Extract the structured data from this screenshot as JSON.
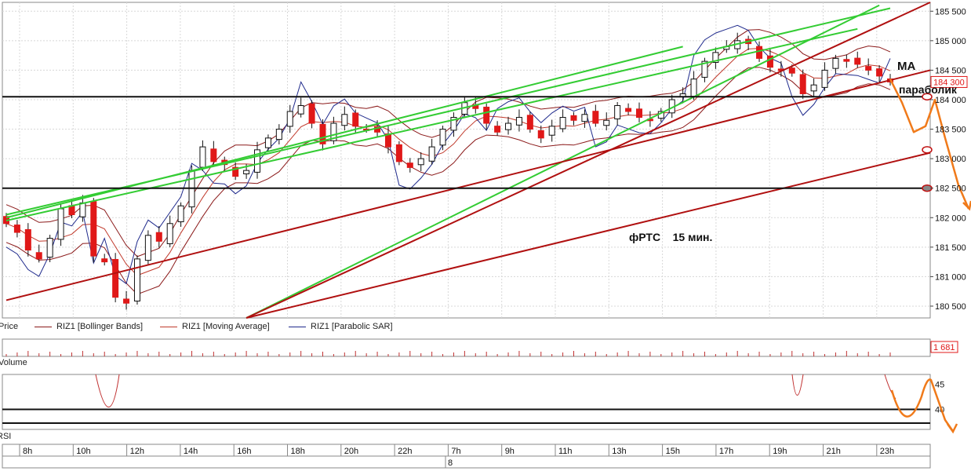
{
  "chart_data": {
    "type": "candlestick",
    "annotation": "фРТС    15 мин.",
    "callouts": [
      "MA",
      "параболик"
    ],
    "price_axis": {
      "ticks": [
        "185 500",
        "185 000",
        "184 500",
        "184 000",
        "183 500",
        "183 000",
        "182 500",
        "182 000",
        "181 500",
        "181 000",
        "180 500"
      ],
      "tick_values": [
        185500,
        185000,
        184500,
        184000,
        183500,
        183000,
        182500,
        182000,
        181500,
        181000,
        180500
      ],
      "ylim": [
        180300,
        185650
      ]
    },
    "last_price_badge": "184 300",
    "volume_badge": "1 681",
    "rsi_axis": {
      "ticks": [
        "45",
        "40"
      ],
      "tick_values": [
        45,
        40
      ]
    },
    "time_axis": {
      "labels": [
        "8h",
        "10h",
        "12h",
        "14h",
        "16h",
        "18h",
        "20h",
        "22h",
        "7h",
        "9h",
        "11h",
        "13h",
        "15h",
        "17h",
        "19h",
        "21h",
        "23h"
      ],
      "date_label": "8"
    },
    "horizontal_levels": [
      184050,
      182500
    ],
    "series_legend": [
      {
        "name": "Price",
        "color": "#000000"
      },
      {
        "name": "RIZ1 [Bollinger Bands]",
        "color": "#8b1a1a"
      },
      {
        "name": "RIZ1 [Moving Average]",
        "color": "#c0392b"
      },
      {
        "name": "RIZ1 [Parabolic SAR]",
        "color": "#1f2a8c"
      }
    ],
    "pane_labels": {
      "volume": "Volume",
      "rsi": "RSI"
    },
    "close_path": [
      181900,
      181750,
      181450,
      181300,
      181650,
      182150,
      182050,
      182250,
      181350,
      181250,
      180650,
      180550,
      181300,
      181700,
      181600,
      181900,
      182200,
      182800,
      183200,
      182950,
      182900,
      182700,
      182800,
      183150,
      183350,
      183500,
      183800,
      183900,
      183600,
      183250,
      183600,
      183750,
      183550,
      183500,
      183450,
      183200,
      182950,
      182850,
      183000,
      183200,
      183500,
      183700,
      183950,
      183850,
      183600,
      183450,
      183600,
      183700,
      183500,
      183350,
      183550,
      183700,
      183650,
      183750,
      183600,
      183650,
      183900,
      183800,
      183700,
      183650,
      183800,
      184000,
      184100,
      184350,
      184650,
      184800,
      184900,
      185000,
      184950,
      184700,
      184550,
      184500,
      184450,
      184100,
      184250,
      184500,
      184700,
      184650,
      184600,
      184500,
      184400,
      184300
    ],
    "colors": {
      "bull": "#ffffff",
      "bear": "#e01818",
      "bollinger": "#8b1a1a",
      "ma": "#c0392b",
      "sar": "#1f2a8c",
      "trend_green": "#33cc33",
      "trend_red": "#b01010",
      "forecast": "#f07a1a",
      "rsi": "#c03030"
    }
  }
}
